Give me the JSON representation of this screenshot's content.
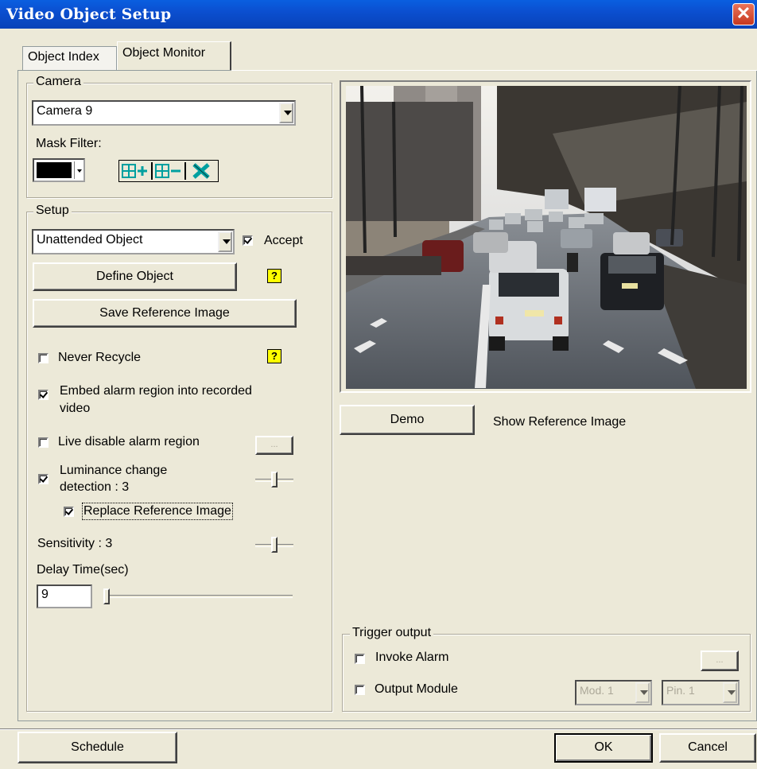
{
  "window": {
    "title": "Video Object Setup"
  },
  "tabs": [
    {
      "label": "Object Index"
    },
    {
      "label": "Object Monitor",
      "active": true
    }
  ],
  "camera": {
    "group_label": "Camera",
    "selected": "Camera 9",
    "mask_filter_label": "Mask Filter:",
    "mask_color": "#000000"
  },
  "setup": {
    "group_label": "Setup",
    "object_type": "Unattended Object",
    "accept_label": "Accept",
    "accept_checked": true,
    "define_object_label": "Define Object",
    "save_reference_label": "Save Reference Image",
    "never_recycle_label": "Never Recycle",
    "never_recycle_checked": false,
    "embed_label_1": "Embed alarm region into recorded",
    "embed_label_2": "video",
    "embed_checked": true,
    "live_disable_label": "Live disable alarm region",
    "live_disable_checked": false,
    "ellipsis_label": "...",
    "luminance_label_1": "Luminance change",
    "luminance_label_2": "detection : 3",
    "luminance_checked": true,
    "replace_reference_label": "Replace Reference Image",
    "replace_reference_checked": true,
    "sensitivity_label": "Sensitivity : 3",
    "delay_label": "Delay Time(sec)",
    "delay_value": "9"
  },
  "preview": {
    "demo_label": "Demo",
    "show_reference_label": "Show Reference Image"
  },
  "trigger": {
    "group_label": "Trigger output",
    "invoke_alarm_label": "Invoke Alarm",
    "invoke_alarm_checked": false,
    "output_module_label": "Output Module",
    "output_module_checked": false,
    "ellipsis_label": "...",
    "module_selected": "Mod. 1",
    "pin_selected": "Pin. 1"
  },
  "footer": {
    "schedule_label": "Schedule",
    "ok_label": "OK",
    "cancel_label": "Cancel"
  },
  "colors": {
    "title_bar": "#0b4fd0",
    "dialog_bg": "#ece9d8",
    "icon_teal": "#00a0a0"
  }
}
